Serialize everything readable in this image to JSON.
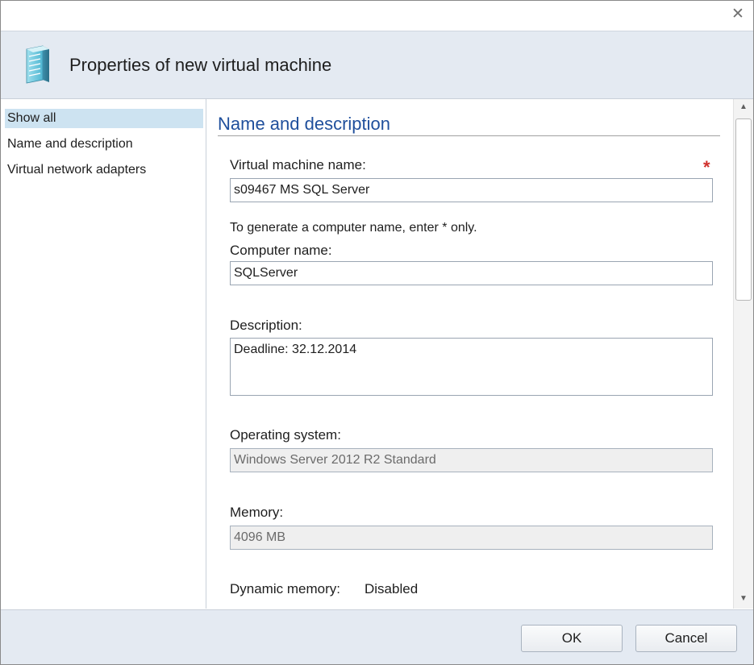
{
  "dialog": {
    "title": "Properties of new virtual machine",
    "close_icon": "close-icon",
    "header_icon": "server-icon"
  },
  "sidebar": {
    "items": [
      {
        "label": "Show all",
        "selected": true
      },
      {
        "label": "Name and description",
        "selected": false
      },
      {
        "label": "Virtual network adapters",
        "selected": false
      }
    ]
  },
  "content": {
    "section_title": "Name and description",
    "vm_name": {
      "label": "Virtual machine name:",
      "value": "s09467 MS SQL Server",
      "required_marker": "*"
    },
    "computer_name": {
      "hint": "To generate a computer name, enter * only.",
      "label": "Computer name:",
      "value": "SQLServer"
    },
    "description": {
      "label": "Description:",
      "value": "Deadline: 32.12.2014"
    },
    "operating_system": {
      "label": "Operating system:",
      "value": "Windows Server 2012 R2 Standard"
    },
    "memory": {
      "label": "Memory:",
      "value": "4096 MB"
    },
    "dynamic_memory": {
      "label": "Dynamic memory:",
      "value": "Disabled"
    }
  },
  "footer": {
    "ok_label": "OK",
    "cancel_label": "Cancel"
  },
  "colors": {
    "header_bg": "#e4eaf2",
    "selected_item_bg": "#cde3f1",
    "section_title": "#1f4f9c",
    "required_marker": "#d0312d"
  }
}
